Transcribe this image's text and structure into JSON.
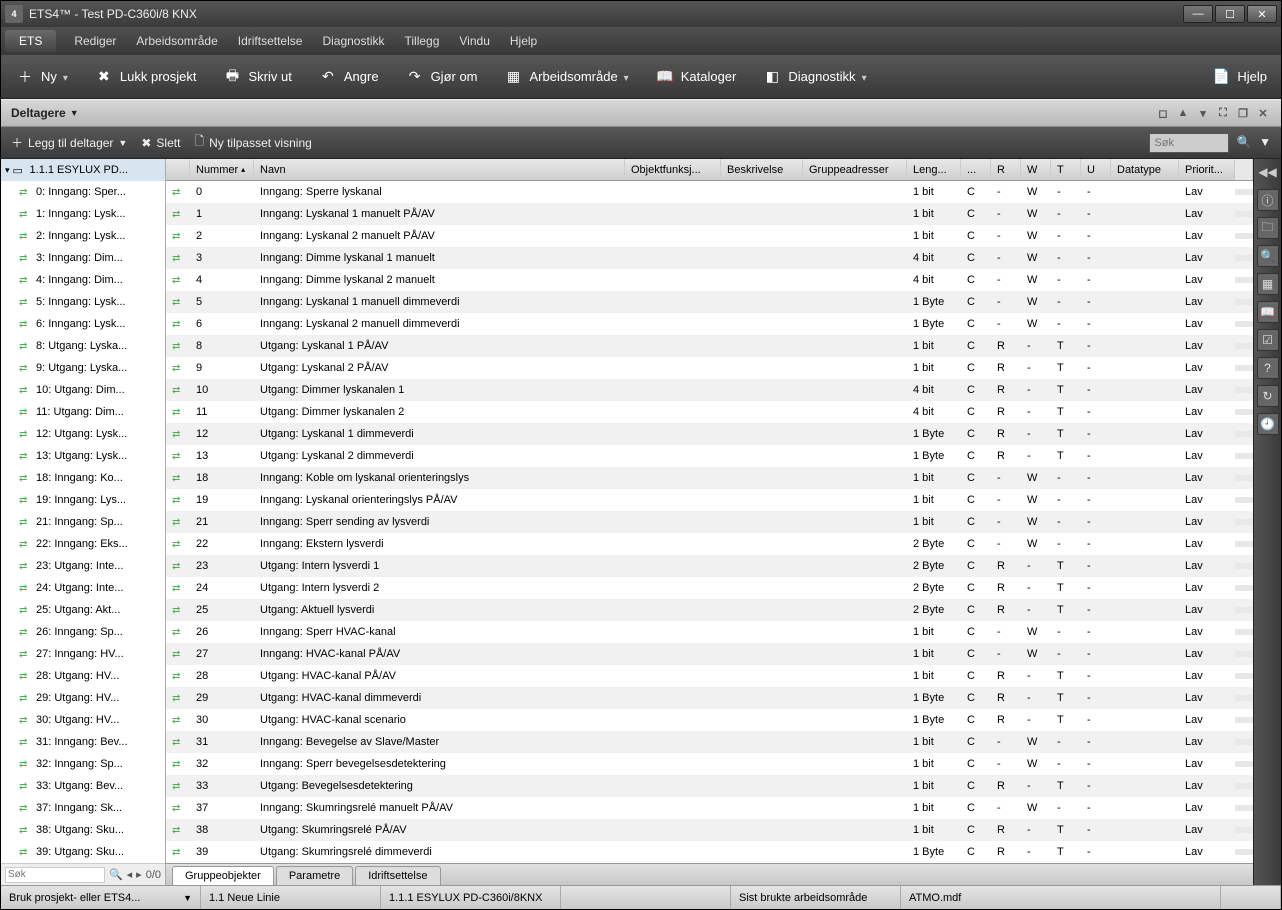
{
  "window": {
    "title": "ETS4™ - Test PD-C360i/8 KNX",
    "app_badge": "4"
  },
  "menubar": {
    "ets": "ETS",
    "items": [
      "Rediger",
      "Arbeidsområde",
      "Idriftsettelse",
      "Diagnostikk",
      "Tillegg",
      "Vindu",
      "Hjelp"
    ]
  },
  "toolbar": {
    "ny": "Ny",
    "lukk": "Lukk prosjekt",
    "skriv": "Skriv ut",
    "angre": "Angre",
    "gjor": "Gjør om",
    "arbeid": "Arbeidsområde",
    "katalog": "Kataloger",
    "diag": "Diagnostikk",
    "hjelp": "Hjelp"
  },
  "panel": {
    "title": "Deltagere",
    "add": "Legg til deltager",
    "slett": "Slett",
    "ny": "Ny tilpasset visning",
    "search_ph": "Søk"
  },
  "tree": {
    "root": "1.1.1  ESYLUX PD...",
    "items": [
      "0: Inngang: Sper...",
      "1: Inngang: Lysk...",
      "2: Inngang: Lysk...",
      "3: Inngang: Dim...",
      "4: Inngang: Dim...",
      "5: Inngang: Lysk...",
      "6: Inngang: Lysk...",
      "8: Utgang: Lyska...",
      "9: Utgang: Lyska...",
      "10: Utgang: Dim...",
      "11: Utgang: Dim...",
      "12: Utgang: Lysk...",
      "13: Utgang: Lysk...",
      "18: Inngang: Ko...",
      "19: Inngang: Lys...",
      "21: Inngang: Sp...",
      "22: Inngang: Eks...",
      "23: Utgang: Inte...",
      "24: Utgang: Inte...",
      "25: Utgang: Akt...",
      "26: Inngang: Sp...",
      "27: Inngang: HV...",
      "28: Utgang: HV...",
      "29: Utgang: HV...",
      "30: Utgang: HV...",
      "31: Inngang: Bev...",
      "32: Inngang: Sp...",
      "33: Utgang: Bev...",
      "37: Inngang: Sk...",
      "38: Utgang: Sku...",
      "39: Utgang: Sku..."
    ],
    "footer_ph": "Søk",
    "footer_count": "0/0"
  },
  "grid": {
    "headers": {
      "num": "Nummer",
      "name": "Navn",
      "fn": "Objektfunksj...",
      "desc": "Beskrivelse",
      "grp": "Gruppeadresser",
      "len": "Leng...",
      "c": "...",
      "r": "R",
      "w": "W",
      "t": "T",
      "u": "U",
      "dt": "Datatype",
      "pr": "Priorit..."
    },
    "rows": [
      {
        "num": "0",
        "name": "Inngang: Sperre lyskanal",
        "len": "1 bit",
        "c": "C",
        "r": "-",
        "w": "W",
        "t": "-",
        "u": "-",
        "pr": "Lav"
      },
      {
        "num": "1",
        "name": "Inngang: Lyskanal 1 manuelt PÅ/AV",
        "len": "1 bit",
        "c": "C",
        "r": "-",
        "w": "W",
        "t": "-",
        "u": "-",
        "pr": "Lav"
      },
      {
        "num": "2",
        "name": "Inngang: Lyskanal 2 manuelt PÅ/AV",
        "len": "1 bit",
        "c": "C",
        "r": "-",
        "w": "W",
        "t": "-",
        "u": "-",
        "pr": "Lav"
      },
      {
        "num": "3",
        "name": "Inngang: Dimme lyskanal 1 manuelt",
        "len": "4 bit",
        "c": "C",
        "r": "-",
        "w": "W",
        "t": "-",
        "u": "-",
        "pr": "Lav"
      },
      {
        "num": "4",
        "name": "Inngang: Dimme lyskanal 2 manuelt",
        "len": "4 bit",
        "c": "C",
        "r": "-",
        "w": "W",
        "t": "-",
        "u": "-",
        "pr": "Lav"
      },
      {
        "num": "5",
        "name": "Inngang: Lyskanal 1 manuell dimmeverdi",
        "len": "1 Byte",
        "c": "C",
        "r": "-",
        "w": "W",
        "t": "-",
        "u": "-",
        "pr": "Lav"
      },
      {
        "num": "6",
        "name": "Inngang: Lyskanal 2 manuell dimmeverdi",
        "len": "1 Byte",
        "c": "C",
        "r": "-",
        "w": "W",
        "t": "-",
        "u": "-",
        "pr": "Lav"
      },
      {
        "num": "8",
        "name": "Utgang: Lyskanal 1 PÅ/AV",
        "len": "1 bit",
        "c": "C",
        "r": "R",
        "w": "-",
        "t": "T",
        "u": "-",
        "pr": "Lav"
      },
      {
        "num": "9",
        "name": "Utgang: Lyskanal 2 PÅ/AV",
        "len": "1 bit",
        "c": "C",
        "r": "R",
        "w": "-",
        "t": "T",
        "u": "-",
        "pr": "Lav"
      },
      {
        "num": "10",
        "name": "Utgang: Dimmer lyskanalen 1",
        "len": "4 bit",
        "c": "C",
        "r": "R",
        "w": "-",
        "t": "T",
        "u": "-",
        "pr": "Lav"
      },
      {
        "num": "11",
        "name": "Utgang: Dimmer lyskanalen 2",
        "len": "4 bit",
        "c": "C",
        "r": "R",
        "w": "-",
        "t": "T",
        "u": "-",
        "pr": "Lav"
      },
      {
        "num": "12",
        "name": "Utgang: Lyskanal 1 dimmeverdi",
        "len": "1 Byte",
        "c": "C",
        "r": "R",
        "w": "-",
        "t": "T",
        "u": "-",
        "pr": "Lav"
      },
      {
        "num": "13",
        "name": "Utgang: Lyskanal 2 dimmeverdi",
        "len": "1 Byte",
        "c": "C",
        "r": "R",
        "w": "-",
        "t": "T",
        "u": "-",
        "pr": "Lav"
      },
      {
        "num": "18",
        "name": "Inngang: Koble om lyskanal orienteringslys",
        "len": "1 bit",
        "c": "C",
        "r": "-",
        "w": "W",
        "t": "-",
        "u": "-",
        "pr": "Lav"
      },
      {
        "num": "19",
        "name": "Inngang: Lyskanal orienteringslys PÅ/AV",
        "len": "1 bit",
        "c": "C",
        "r": "-",
        "w": "W",
        "t": "-",
        "u": "-",
        "pr": "Lav"
      },
      {
        "num": "21",
        "name": "Inngang: Sperr sending av lysverdi",
        "len": "1 bit",
        "c": "C",
        "r": "-",
        "w": "W",
        "t": "-",
        "u": "-",
        "pr": "Lav"
      },
      {
        "num": "22",
        "name": "Inngang: Ekstern lysverdi",
        "len": "2 Byte",
        "c": "C",
        "r": "-",
        "w": "W",
        "t": "-",
        "u": "-",
        "pr": "Lav"
      },
      {
        "num": "23",
        "name": "Utgang: Intern lysverdi 1",
        "len": "2 Byte",
        "c": "C",
        "r": "R",
        "w": "-",
        "t": "T",
        "u": "-",
        "pr": "Lav"
      },
      {
        "num": "24",
        "name": "Utgang: Intern lysverdi 2",
        "len": "2 Byte",
        "c": "C",
        "r": "R",
        "w": "-",
        "t": "T",
        "u": "-",
        "pr": "Lav"
      },
      {
        "num": "25",
        "name": "Utgang: Aktuell lysverdi",
        "len": "2 Byte",
        "c": "C",
        "r": "R",
        "w": "-",
        "t": "T",
        "u": "-",
        "pr": "Lav"
      },
      {
        "num": "26",
        "name": "Inngang: Sperr HVAC-kanal",
        "len": "1 bit",
        "c": "C",
        "r": "-",
        "w": "W",
        "t": "-",
        "u": "-",
        "pr": "Lav"
      },
      {
        "num": "27",
        "name": "Inngang: HVAC-kanal PÅ/AV",
        "len": "1 bit",
        "c": "C",
        "r": "-",
        "w": "W",
        "t": "-",
        "u": "-",
        "pr": "Lav"
      },
      {
        "num": "28",
        "name": "Utgang: HVAC-kanal PÅ/AV",
        "len": "1 bit",
        "c": "C",
        "r": "R",
        "w": "-",
        "t": "T",
        "u": "-",
        "pr": "Lav"
      },
      {
        "num": "29",
        "name": "Utgang: HVAC-kanal dimmeverdi",
        "len": "1 Byte",
        "c": "C",
        "r": "R",
        "w": "-",
        "t": "T",
        "u": "-",
        "pr": "Lav"
      },
      {
        "num": "30",
        "name": "Utgang: HVAC-kanal scenario",
        "len": "1 Byte",
        "c": "C",
        "r": "R",
        "w": "-",
        "t": "T",
        "u": "-",
        "pr": "Lav"
      },
      {
        "num": "31",
        "name": "Inngang: Bevegelse av Slave/Master",
        "len": "1 bit",
        "c": "C",
        "r": "-",
        "w": "W",
        "t": "-",
        "u": "-",
        "pr": "Lav"
      },
      {
        "num": "32",
        "name": "Inngang: Sperr bevegelsesdetektering",
        "len": "1 bit",
        "c": "C",
        "r": "-",
        "w": "W",
        "t": "-",
        "u": "-",
        "pr": "Lav"
      },
      {
        "num": "33",
        "name": "Utgang: Bevegelsesdetektering",
        "len": "1 bit",
        "c": "C",
        "r": "R",
        "w": "-",
        "t": "T",
        "u": "-",
        "pr": "Lav"
      },
      {
        "num": "37",
        "name": "Inngang: Skumringsrelé manuelt PÅ/AV",
        "len": "1 bit",
        "c": "C",
        "r": "-",
        "w": "W",
        "t": "-",
        "u": "-",
        "pr": "Lav"
      },
      {
        "num": "38",
        "name": "Utgang: Skumringsrelé PÅ/AV",
        "len": "1 bit",
        "c": "C",
        "r": "R",
        "w": "-",
        "t": "T",
        "u": "-",
        "pr": "Lav"
      },
      {
        "num": "39",
        "name": "Utgang: Skumringsrelé dimmeverdi",
        "len": "1 Byte",
        "c": "C",
        "r": "R",
        "w": "-",
        "t": "T",
        "u": "-",
        "pr": "Lav"
      }
    ]
  },
  "tabs": {
    "t1": "Gruppeobjekter",
    "t2": "Parametre",
    "t3": "Idriftsettelse"
  },
  "status": {
    "s1": "Bruk prosjekt- eller ETS4...",
    "s2": "1.1 Neue Linie",
    "s3": "1.1.1  ESYLUX PD-C360i/8KNX",
    "s4": "",
    "s5": "Sist brukte arbeidsområde",
    "s6": "ATMO.mdf"
  }
}
